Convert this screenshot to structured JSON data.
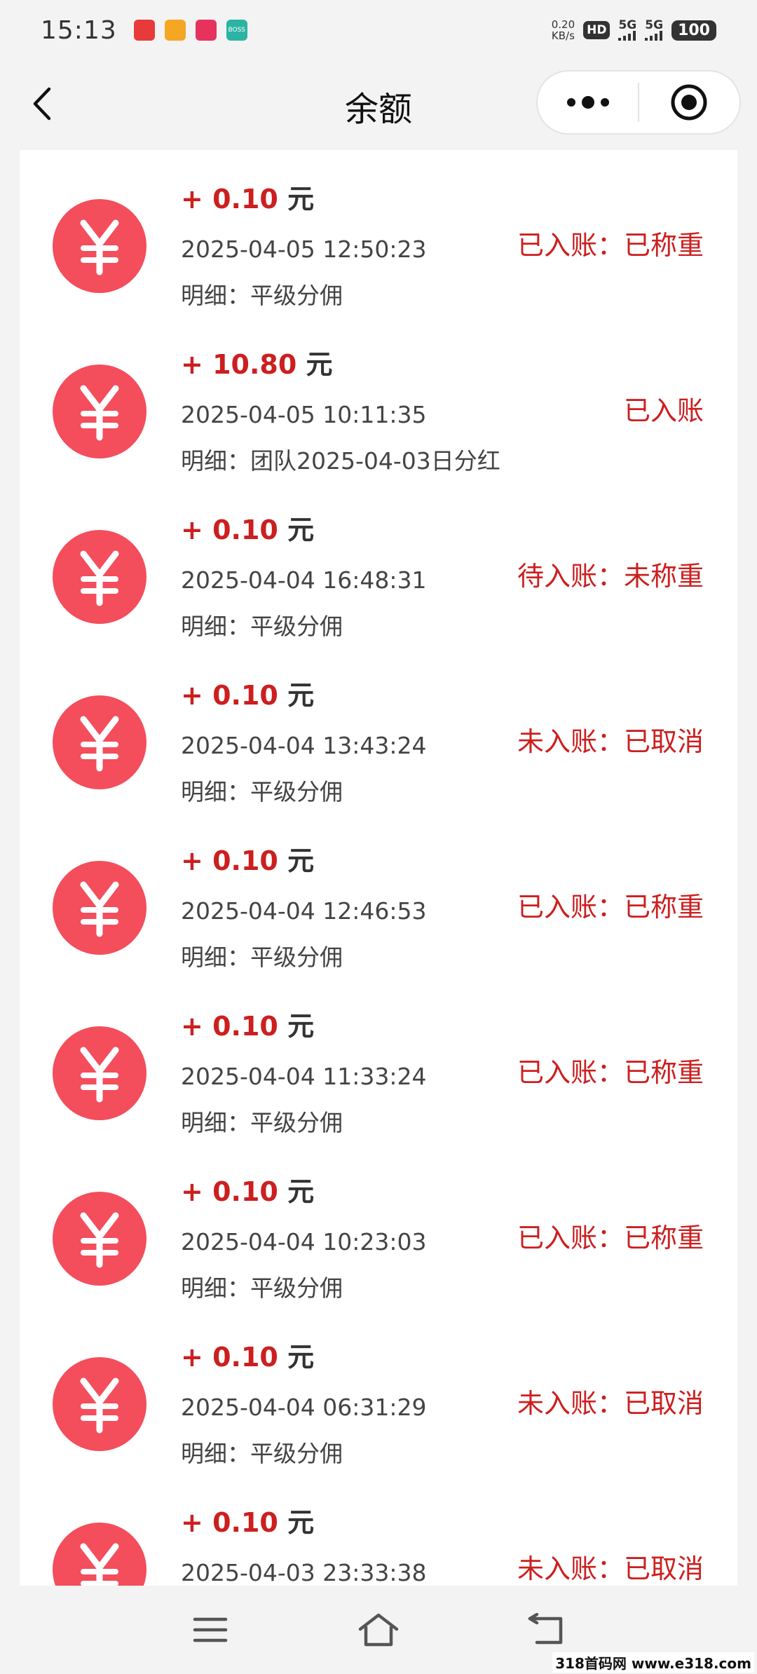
{
  "status_bar": {
    "time": "15:13",
    "net_speed_value": "0.20",
    "net_speed_unit": "KB/s",
    "hd_label": "HD",
    "signal_1_label": "5G",
    "signal_2_label": "5G",
    "battery": "100",
    "app_icons": [
      {
        "name": "app-icon-1",
        "color": "#e83a3a"
      },
      {
        "name": "app-icon-2",
        "color": "#f5a623"
      },
      {
        "name": "app-icon-3",
        "color": "#e8325e"
      },
      {
        "name": "app-icon-boss",
        "color": "#2bb3a3",
        "label": "BOSS"
      }
    ]
  },
  "header": {
    "title": "余额"
  },
  "records": [
    {
      "sign": "+",
      "amount": "0.10",
      "unit": "元",
      "time": "2025-04-05 12:50:23",
      "detail": "明细：平级分佣",
      "status": "已入账：已称重"
    },
    {
      "sign": "+",
      "amount": "10.80",
      "unit": "元",
      "time": "2025-04-05 10:11:35",
      "detail": "明细：团队2025-04-03日分红",
      "status": "已入账"
    },
    {
      "sign": "+",
      "amount": "0.10",
      "unit": "元",
      "time": "2025-04-04 16:48:31",
      "detail": "明细：平级分佣",
      "status": "待入账：未称重"
    },
    {
      "sign": "+",
      "amount": "0.10",
      "unit": "元",
      "time": "2025-04-04 13:43:24",
      "detail": "明细：平级分佣",
      "status": "未入账：已取消"
    },
    {
      "sign": "+",
      "amount": "0.10",
      "unit": "元",
      "time": "2025-04-04 12:46:53",
      "detail": "明细：平级分佣",
      "status": "已入账：已称重"
    },
    {
      "sign": "+",
      "amount": "0.10",
      "unit": "元",
      "time": "2025-04-04 11:33:24",
      "detail": "明细：平级分佣",
      "status": "已入账：已称重"
    },
    {
      "sign": "+",
      "amount": "0.10",
      "unit": "元",
      "time": "2025-04-04 10:23:03",
      "detail": "明细：平级分佣",
      "status": "已入账：已称重"
    },
    {
      "sign": "+",
      "amount": "0.10",
      "unit": "元",
      "time": "2025-04-04 06:31:29",
      "detail": "明细：平级分佣",
      "status": "未入账：已取消"
    },
    {
      "sign": "+",
      "amount": "0.10",
      "unit": "元",
      "time": "2025-04-03 23:33:38",
      "detail": "",
      "status": "未入账：已取消"
    }
  ],
  "colors": {
    "accent_red": "#cc1f1f",
    "coin_red": "#f44d5c"
  },
  "watermark": "318首码网 www.e318.com"
}
